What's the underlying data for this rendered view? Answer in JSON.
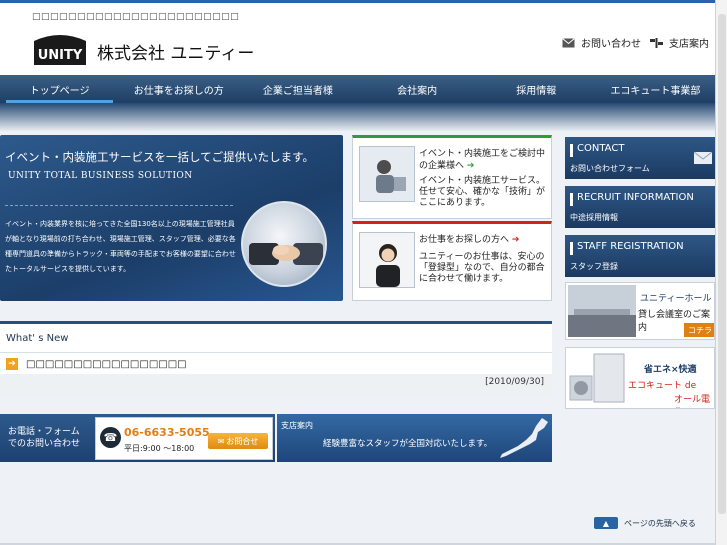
{
  "header": {
    "tagline": "□□□□□□□□□□□□□□□□□□□□□□□",
    "logo_text": "UNITY",
    "company": "株式会社 ユニティー",
    "contact_link": "お問い合わせ",
    "branch_link": "支店案内"
  },
  "nav": {
    "items": [
      {
        "label": "トップページ"
      },
      {
        "label": "お仕事をお探しの方"
      },
      {
        "label": "企業ご担当者様"
      },
      {
        "label": "会社案内"
      },
      {
        "label": "採用情報"
      },
      {
        "label": "エコキュート事業部"
      }
    ]
  },
  "hero": {
    "title": "イベント・内装施工サービスを一括してご提供いたします。",
    "subtitle": "UNITY TOTAL BUSINESS  SOLUTION",
    "body": "イベント・内装業界を核に培ってきた全国130名以上の現場施工管理社員が軸となり現場前の打ち合わせ、現場施工管理、スタッフ管理、必要な各種専門道具の準備からトラック・車両等の手配までお客様の要望に合わせたトータルサービスを提供しています。"
  },
  "cards": {
    "company": {
      "title": "イベント・内装施工をご検討中の企業様へ",
      "body": "イベント・内装施工サービス。任せて安心、確かな「技術」がここにあります。"
    },
    "job": {
      "title": "お仕事をお探しの方へ",
      "body": "ユニティーのお仕事は、安心の「登録型」なので、自分の都合に合わせて働けます。"
    }
  },
  "side": {
    "contact": {
      "title": "CONTACT",
      "sub": "お問い合わせフォーム"
    },
    "recruit": {
      "title": "RECRUIT INFORMATION",
      "sub": "中途採用情報"
    },
    "staff": {
      "title": "STAFF REGISTRATION",
      "sub": "スタッフ登録"
    },
    "hall": {
      "title": "ユニティーホール",
      "sub": "貸し会議室のご案内",
      "more": "コチラ"
    },
    "eco": {
      "line1": "省エネ×快適",
      "line2": "エコキュート de",
      "line3": "オール電化"
    }
  },
  "news": {
    "title": "What' s New",
    "items": [
      {
        "text": "□□□□□□□□□□□□□□□□□"
      }
    ],
    "date": "[2010/09/30]"
  },
  "contact": {
    "label_line1": "お電話・フォーム",
    "label_line2": "でのお問い合わせ",
    "tel": "06-6633-5055",
    "hours": "平日:9:00 ～18:00",
    "mail_button": "お問合せ"
  },
  "branch": {
    "title": "支店案内",
    "text": "経験豊富なスタッフが全国対応いたします。"
  },
  "footer": {
    "back_to_top": "ページの先頭へ戻る"
  }
}
